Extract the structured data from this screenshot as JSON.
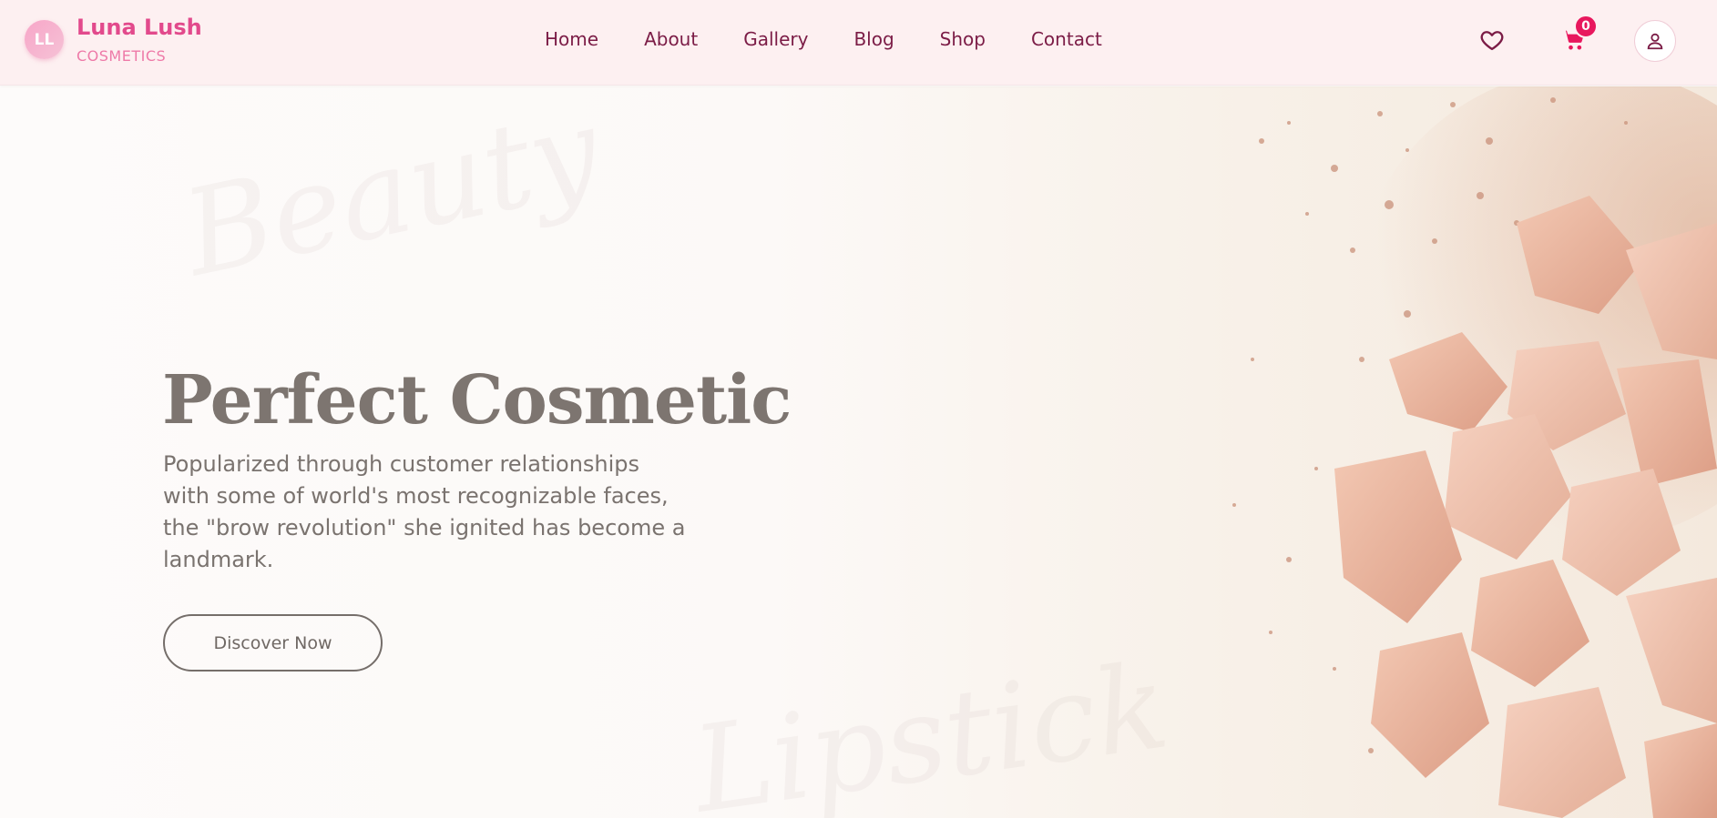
{
  "brand": {
    "initials": "LL",
    "name": "Luna Lush",
    "subtitle": "COSMETICS",
    "colors": {
      "primary": "#e24a8c",
      "nav": "#7b1c46",
      "badge": "#e8175d",
      "header_bg": "#fdf0f1"
    }
  },
  "nav": {
    "items": [
      {
        "label": "Home"
      },
      {
        "label": "About"
      },
      {
        "label": "Gallery"
      },
      {
        "label": "Blog"
      },
      {
        "label": "Shop"
      },
      {
        "label": "Contact"
      }
    ]
  },
  "header_actions": {
    "wishlist_icon": "heart-icon",
    "cart_icon": "cart-icon",
    "cart_count": "0",
    "account_icon": "user-icon"
  },
  "hero": {
    "title": "Perfect Cosmetic",
    "description": "Popularized through customer relationships with some of world's most recognizable faces, the \"brow revolution\" she ignited has become a landmark.",
    "cta_label": "Discover Now",
    "image": "crushed-powder-image"
  }
}
